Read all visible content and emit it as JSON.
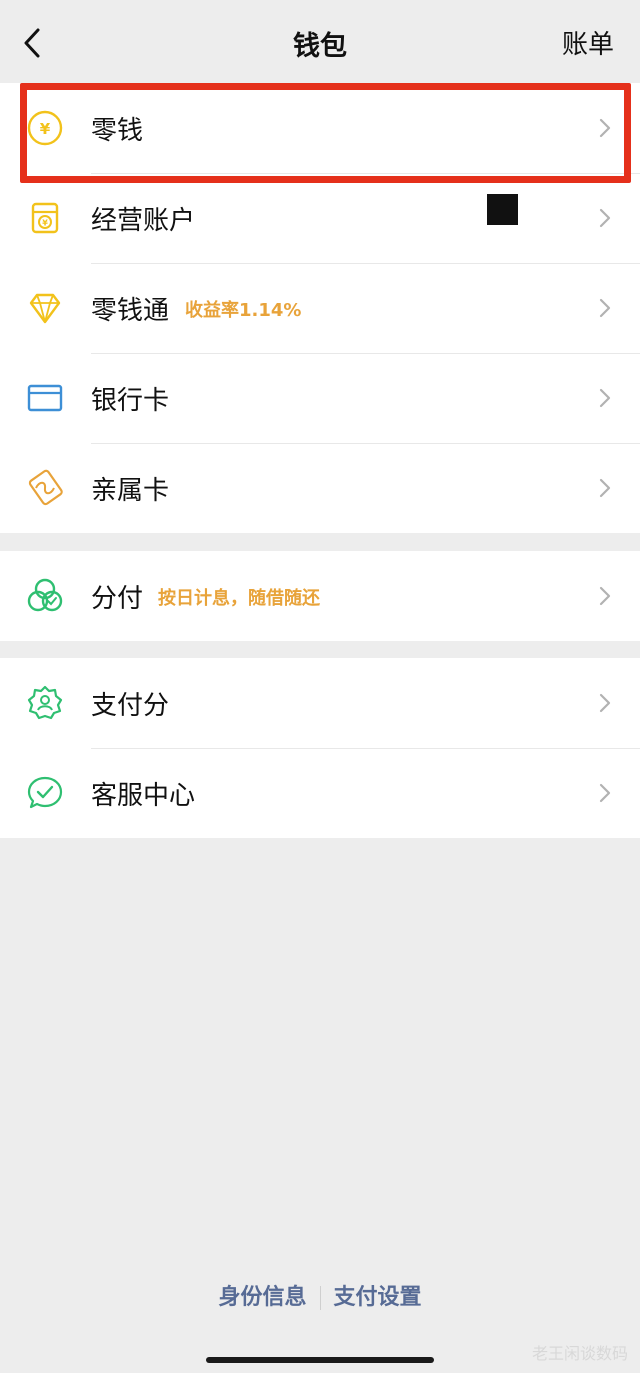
{
  "nav": {
    "title": "钱包",
    "right_label": "账单"
  },
  "group1": [
    {
      "label": "零钱",
      "icon": "yuan-coin-icon"
    },
    {
      "label": "经营账户",
      "icon": "business-account-icon"
    },
    {
      "label": "零钱通",
      "icon": "diamond-icon",
      "tag": "收益率1.14%"
    },
    {
      "label": "银行卡",
      "icon": "bank-card-icon"
    },
    {
      "label": "亲属卡",
      "icon": "family-card-icon"
    }
  ],
  "group2": [
    {
      "label": "分付",
      "icon": "fenfu-icon",
      "tag": "按日计息，随借随还"
    }
  ],
  "group3": [
    {
      "label": "支付分",
      "icon": "pay-score-icon"
    },
    {
      "label": "客服中心",
      "icon": "customer-service-icon"
    }
  ],
  "footer": {
    "identity": "身份信息",
    "settings": "支付设置"
  },
  "watermark": "老王闲谈数码",
  "colors": {
    "background": "#ededed",
    "highlight_border": "#e5301b",
    "tag_orange": "#e8a33a",
    "link_blue": "#576b95",
    "icon_yellow": "#f2c21b",
    "icon_blue": "#3d8fd6",
    "icon_orange": "#e8a33a",
    "icon_green": "#2fbf71"
  }
}
